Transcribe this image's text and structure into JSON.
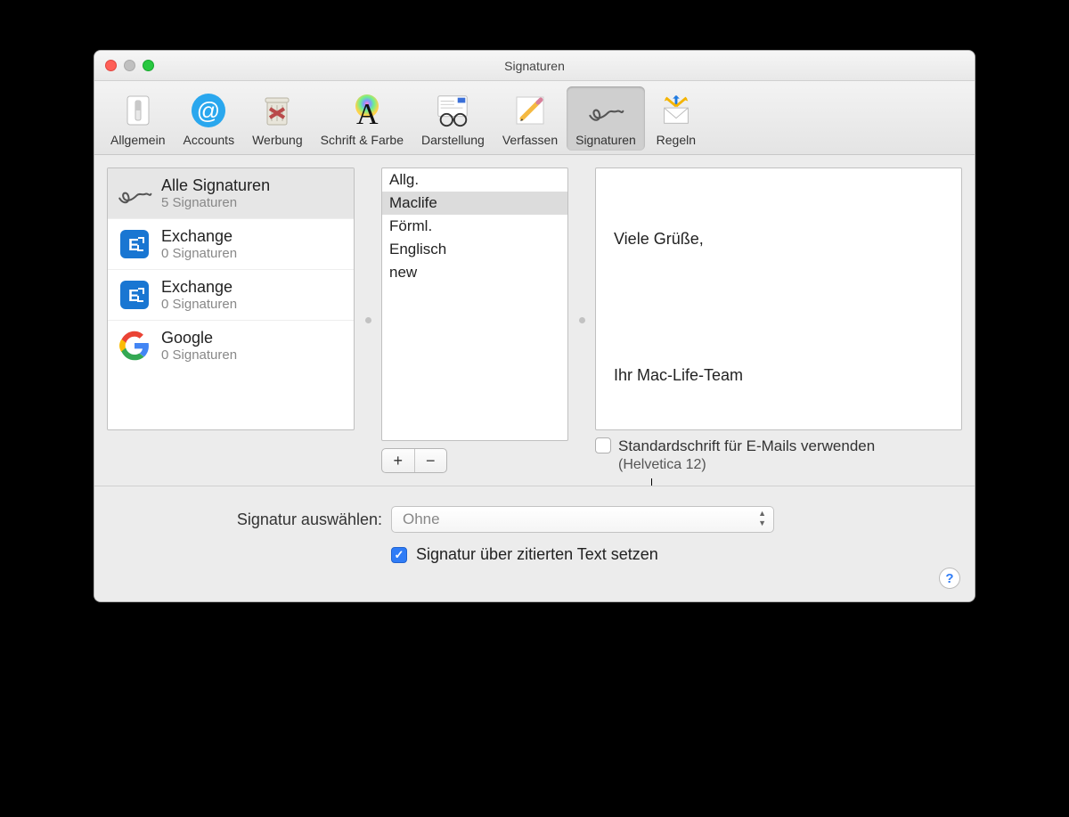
{
  "window": {
    "title": "Signaturen"
  },
  "toolbar": {
    "items": [
      {
        "id": "general",
        "label": "Allgemein",
        "icon": "switch-icon",
        "selected": false
      },
      {
        "id": "accounts",
        "label": "Accounts",
        "icon": "at-icon",
        "selected": false
      },
      {
        "id": "junk",
        "label": "Werbung",
        "icon": "trash-icon",
        "selected": false
      },
      {
        "id": "fonts",
        "label": "Schrift & Farbe",
        "icon": "font-icon",
        "selected": false
      },
      {
        "id": "viewing",
        "label": "Darstellung",
        "icon": "glasses-icon",
        "selected": false
      },
      {
        "id": "compose",
        "label": "Verfassen",
        "icon": "pencil-icon",
        "selected": false
      },
      {
        "id": "signatures",
        "label": "Signaturen",
        "icon": "signature-icon",
        "selected": true
      },
      {
        "id": "rules",
        "label": "Regeln",
        "icon": "rules-icon",
        "selected": false
      }
    ]
  },
  "accounts": [
    {
      "name": "Alle Signaturen",
      "sub": "5 Signaturen",
      "icon": "signature-icon",
      "selected": true
    },
    {
      "name": "Exchange",
      "sub": "0 Signaturen",
      "icon": "exchange-icon",
      "selected": false
    },
    {
      "name": "Exchange",
      "sub": "0 Signaturen",
      "icon": "exchange-icon",
      "selected": false
    },
    {
      "name": "Google",
      "sub": "0 Signaturen",
      "icon": "google-icon",
      "selected": false
    }
  ],
  "signatures": [
    {
      "name": "Allg.",
      "selected": false
    },
    {
      "name": "Maclife",
      "selected": true
    },
    {
      "name": "Förml.",
      "selected": false
    },
    {
      "name": "Englisch",
      "selected": false
    },
    {
      "name": "new",
      "selected": false
    }
  ],
  "editor": {
    "line1": "Viele Grüße,",
    "line2": "Ihr Mac-Life-Team"
  },
  "controls": {
    "add": "+",
    "remove": "−",
    "default_font_label": "Standardschrift für E-Mails verwenden",
    "default_font_sub": "(Helvetica 12)",
    "default_font_checked": false,
    "choose_label": "Signatur auswählen:",
    "choose_value": "Ohne",
    "above_quoted_label": "Signatur über zitierten Text setzen",
    "above_quoted_checked": true,
    "help": "?"
  }
}
